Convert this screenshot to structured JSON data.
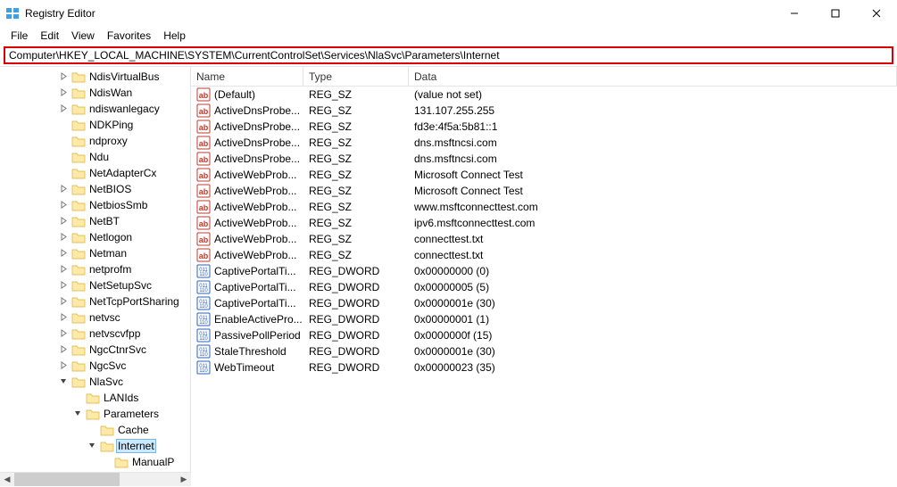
{
  "window": {
    "title": "Registry Editor"
  },
  "menu": {
    "file": "File",
    "edit": "Edit",
    "view": "View",
    "favorites": "Favorites",
    "help": "Help"
  },
  "address": "Computer\\HKEY_LOCAL_MACHINE\\SYSTEM\\CurrentControlSet\\Services\\NlaSvc\\Parameters\\Internet",
  "tree": [
    {
      "depth": 4,
      "exp": "closed",
      "label": "NdisVirtualBus"
    },
    {
      "depth": 4,
      "exp": "closed",
      "label": "NdisWan"
    },
    {
      "depth": 4,
      "exp": "closed",
      "label": "ndiswanlegacy"
    },
    {
      "depth": 4,
      "exp": "none",
      "label": "NDKPing"
    },
    {
      "depth": 4,
      "exp": "none",
      "label": "ndproxy"
    },
    {
      "depth": 4,
      "exp": "none",
      "label": "Ndu"
    },
    {
      "depth": 4,
      "exp": "none",
      "label": "NetAdapterCx"
    },
    {
      "depth": 4,
      "exp": "closed",
      "label": "NetBIOS"
    },
    {
      "depth": 4,
      "exp": "closed",
      "label": "NetbiosSmb"
    },
    {
      "depth": 4,
      "exp": "closed",
      "label": "NetBT"
    },
    {
      "depth": 4,
      "exp": "closed",
      "label": "Netlogon"
    },
    {
      "depth": 4,
      "exp": "closed",
      "label": "Netman"
    },
    {
      "depth": 4,
      "exp": "closed",
      "label": "netprofm"
    },
    {
      "depth": 4,
      "exp": "closed",
      "label": "NetSetupSvc"
    },
    {
      "depth": 4,
      "exp": "closed",
      "label": "NetTcpPortSharing"
    },
    {
      "depth": 4,
      "exp": "closed",
      "label": "netvsc"
    },
    {
      "depth": 4,
      "exp": "closed",
      "label": "netvscvfpp"
    },
    {
      "depth": 4,
      "exp": "closed",
      "label": "NgcCtnrSvc"
    },
    {
      "depth": 4,
      "exp": "closed",
      "label": "NgcSvc"
    },
    {
      "depth": 4,
      "exp": "open",
      "label": "NlaSvc"
    },
    {
      "depth": 5,
      "exp": "none",
      "label": "LANIds"
    },
    {
      "depth": 5,
      "exp": "open",
      "label": "Parameters"
    },
    {
      "depth": 6,
      "exp": "none",
      "label": "Cache"
    },
    {
      "depth": 6,
      "exp": "open",
      "label": "Internet",
      "selected": true
    },
    {
      "depth": 7,
      "exp": "none",
      "label": "ManualP"
    }
  ],
  "columns": {
    "name": "Name",
    "type": "Type",
    "data": "Data"
  },
  "values": [
    {
      "kind": "sz",
      "name": "(Default)",
      "type": "REG_SZ",
      "data": "(value not set)"
    },
    {
      "kind": "sz",
      "name": "ActiveDnsProbe...",
      "type": "REG_SZ",
      "data": "131.107.255.255"
    },
    {
      "kind": "sz",
      "name": "ActiveDnsProbe...",
      "type": "REG_SZ",
      "data": "fd3e:4f5a:5b81::1"
    },
    {
      "kind": "sz",
      "name": "ActiveDnsProbe...",
      "type": "REG_SZ",
      "data": "dns.msftncsi.com"
    },
    {
      "kind": "sz",
      "name": "ActiveDnsProbe...",
      "type": "REG_SZ",
      "data": "dns.msftncsi.com"
    },
    {
      "kind": "sz",
      "name": "ActiveWebProb...",
      "type": "REG_SZ",
      "data": "Microsoft Connect Test"
    },
    {
      "kind": "sz",
      "name": "ActiveWebProb...",
      "type": "REG_SZ",
      "data": "Microsoft Connect Test"
    },
    {
      "kind": "sz",
      "name": "ActiveWebProb...",
      "type": "REG_SZ",
      "data": "www.msftconnecttest.com"
    },
    {
      "kind": "sz",
      "name": "ActiveWebProb...",
      "type": "REG_SZ",
      "data": "ipv6.msftconnecttest.com"
    },
    {
      "kind": "sz",
      "name": "ActiveWebProb...",
      "type": "REG_SZ",
      "data": "connecttest.txt"
    },
    {
      "kind": "sz",
      "name": "ActiveWebProb...",
      "type": "REG_SZ",
      "data": "connecttest.txt"
    },
    {
      "kind": "dw",
      "name": "CaptivePortalTi...",
      "type": "REG_DWORD",
      "data": "0x00000000 (0)"
    },
    {
      "kind": "dw",
      "name": "CaptivePortalTi...",
      "type": "REG_DWORD",
      "data": "0x00000005 (5)"
    },
    {
      "kind": "dw",
      "name": "CaptivePortalTi...",
      "type": "REG_DWORD",
      "data": "0x0000001e (30)"
    },
    {
      "kind": "dw",
      "name": "EnableActivePro...",
      "type": "REG_DWORD",
      "data": "0x00000001 (1)"
    },
    {
      "kind": "dw",
      "name": "PassivePollPeriod",
      "type": "REG_DWORD",
      "data": "0x0000000f (15)"
    },
    {
      "kind": "dw",
      "name": "StaleThreshold",
      "type": "REG_DWORD",
      "data": "0x0000001e (30)"
    },
    {
      "kind": "dw",
      "name": "WebTimeout",
      "type": "REG_DWORD",
      "data": "0x00000023 (35)"
    }
  ]
}
